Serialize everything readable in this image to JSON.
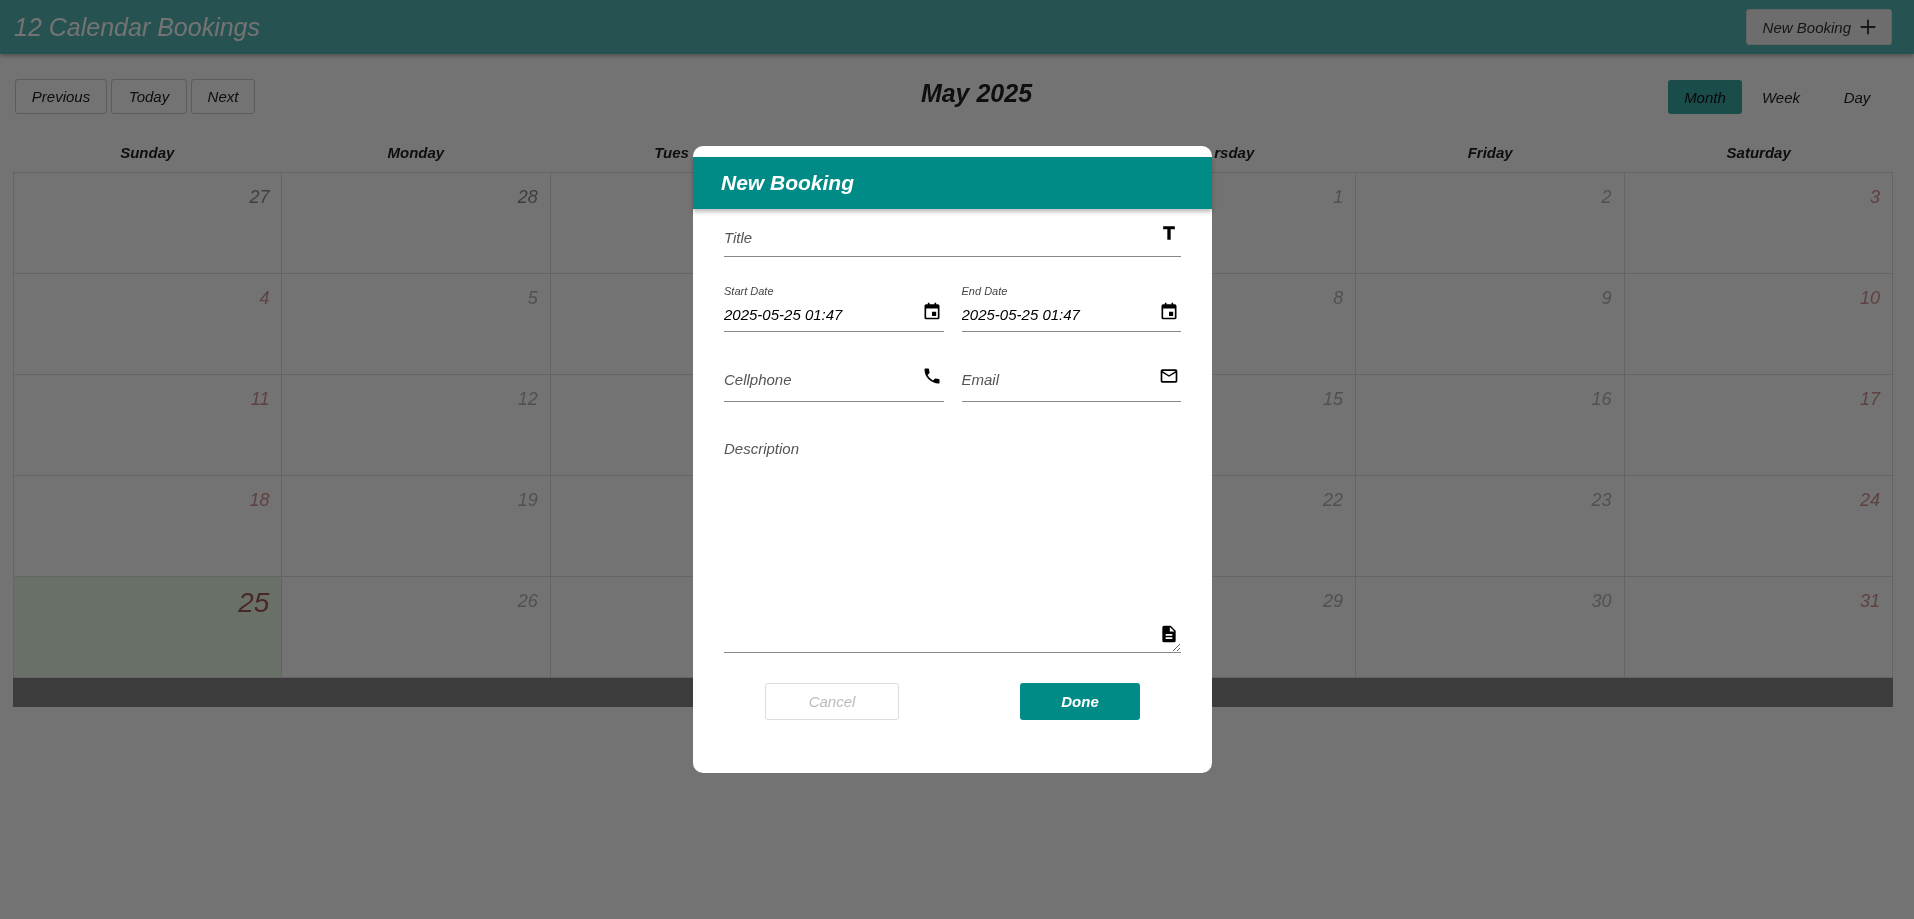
{
  "app_bar": {
    "title": "12 Calendar Bookings",
    "new_button": "New Booking"
  },
  "toolbar": {
    "nav_buttons": [
      "Previous",
      "Today",
      "Next"
    ],
    "month_title": "May 2025",
    "views": [
      {
        "label": "Month",
        "selected": true
      },
      {
        "label": "Week",
        "selected": false
      },
      {
        "label": "Day",
        "selected": false
      }
    ]
  },
  "calendar": {
    "weekdays": [
      {
        "label": "Sunday",
        "kind": "full"
      },
      {
        "label": "Monday",
        "kind": "full"
      },
      {
        "label": "Tues",
        "kind": "cut_end"
      },
      {
        "kind": "blank"
      },
      {
        "label": "rsday",
        "kind": "cut_start"
      },
      {
        "label": "Friday",
        "kind": "full"
      },
      {
        "label": "Saturday",
        "kind": "full"
      }
    ],
    "weeks": [
      [
        {
          "day": "27",
          "kind": "outside"
        },
        {
          "day": "28",
          "kind": "outside"
        },
        {
          "kind": "blank"
        },
        {
          "kind": "blank"
        },
        {
          "day": "1",
          "kind": "weekday"
        },
        {
          "day": "2",
          "kind": "weekday"
        },
        {
          "day": "3",
          "kind": "weekend"
        }
      ],
      [
        {
          "day": "4",
          "kind": "weekend"
        },
        {
          "day": "5",
          "kind": "weekday"
        },
        {
          "kind": "blank"
        },
        {
          "kind": "blank"
        },
        {
          "day": "8",
          "kind": "weekday"
        },
        {
          "day": "9",
          "kind": "weekday"
        },
        {
          "day": "10",
          "kind": "weekend"
        }
      ],
      [
        {
          "day": "11",
          "kind": "weekend"
        },
        {
          "day": "12",
          "kind": "weekday"
        },
        {
          "kind": "blank"
        },
        {
          "kind": "blank"
        },
        {
          "day": "15",
          "kind": "weekday"
        },
        {
          "day": "16",
          "kind": "weekday"
        },
        {
          "day": "17",
          "kind": "weekend"
        }
      ],
      [
        {
          "day": "18",
          "kind": "weekend"
        },
        {
          "day": "19",
          "kind": "weekday"
        },
        {
          "kind": "blank"
        },
        {
          "kind": "blank"
        },
        {
          "day": "22",
          "kind": "weekday"
        },
        {
          "day": "23",
          "kind": "weekday"
        },
        {
          "day": "24",
          "kind": "weekend"
        }
      ],
      [
        {
          "day": "25",
          "kind": "today"
        },
        {
          "day": "26",
          "kind": "weekday"
        },
        {
          "kind": "blank"
        },
        {
          "kind": "blank"
        },
        {
          "day": "29",
          "kind": "weekday"
        },
        {
          "day": "30",
          "kind": "weekday"
        },
        {
          "day": "31",
          "kind": "weekend"
        }
      ]
    ]
  },
  "modal": {
    "title": "New Booking",
    "rows": [
      [
        {
          "kind": "title",
          "placeholder": "Title"
        }
      ],
      [
        {
          "kind": "date",
          "label": "Start Date",
          "value": "2025-05-25 01:47"
        },
        {
          "kind": "date",
          "label": "End Date",
          "value": "2025-05-25 01:47"
        }
      ],
      [
        {
          "kind": "phone",
          "placeholder": "Cellphone"
        },
        {
          "kind": "email",
          "placeholder": "Email"
        }
      ],
      [
        {
          "kind": "description",
          "placeholder": "Description"
        }
      ]
    ],
    "buttons": [
      {
        "label": "Cancel",
        "kind": "outline",
        "disabled": true
      },
      {
        "label": "Done",
        "kind": "filled",
        "disabled": false
      }
    ]
  }
}
